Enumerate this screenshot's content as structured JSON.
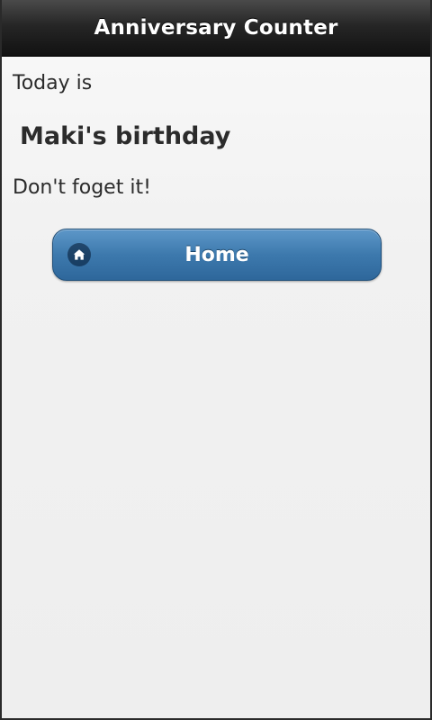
{
  "header": {
    "title": "Anniversary Counter"
  },
  "main": {
    "today_text": "Today is",
    "event_title": "Maki's birthday",
    "reminder_text": "Don't foget it!"
  },
  "home_button": {
    "label": "Home",
    "icon": "home-icon",
    "color": "#3d79ad"
  },
  "colors": {
    "header_bg": "#1c1c1c",
    "page_bg": "#f1f1f1",
    "text": "#2b2b2b"
  }
}
